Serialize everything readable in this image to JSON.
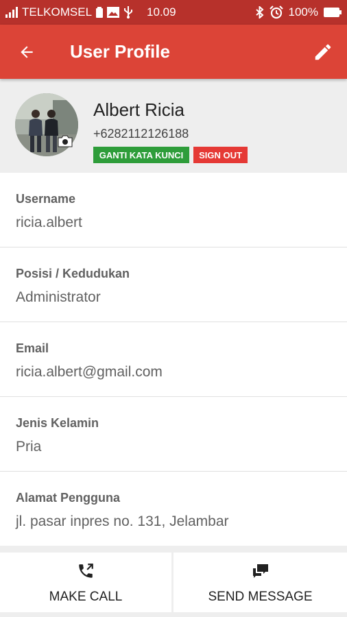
{
  "status_bar": {
    "carrier": "TELKOMSEL",
    "time": "10.09",
    "battery": "100%",
    "icons": [
      "signal-icon",
      "battery-saver-icon",
      "image-icon",
      "usb-icon",
      "bluetooth-icon",
      "alarm-icon",
      "battery-icon"
    ]
  },
  "toolbar": {
    "title": "User Profile",
    "back_icon": "arrow-back-icon",
    "edit_icon": "pencil-icon",
    "color": "#dc4437"
  },
  "profile": {
    "name": "Albert Ricia",
    "phone": "+6282112126188",
    "change_password_label": "GANTI KATA KUNCI",
    "sign_out_label": "SIGN OUT",
    "change_password_color": "#2e9d3a",
    "sign_out_color": "#e53935"
  },
  "fields": [
    {
      "label": "Username",
      "value": "ricia.albert"
    },
    {
      "label": "Posisi / Kedudukan",
      "value": "Administrator"
    },
    {
      "label": "Email",
      "value": "ricia.albert@gmail.com"
    },
    {
      "label": "Jenis Kelamin",
      "value": "Pria"
    },
    {
      "label": "Alamat Pengguna",
      "value": "jl. pasar inpres no. 131, Jelambar"
    }
  ],
  "actions": {
    "call_label": "MAKE CALL",
    "message_label": "SEND MESSAGE",
    "call_icon": "phone-call-icon",
    "message_icon": "chat-bubbles-icon"
  }
}
